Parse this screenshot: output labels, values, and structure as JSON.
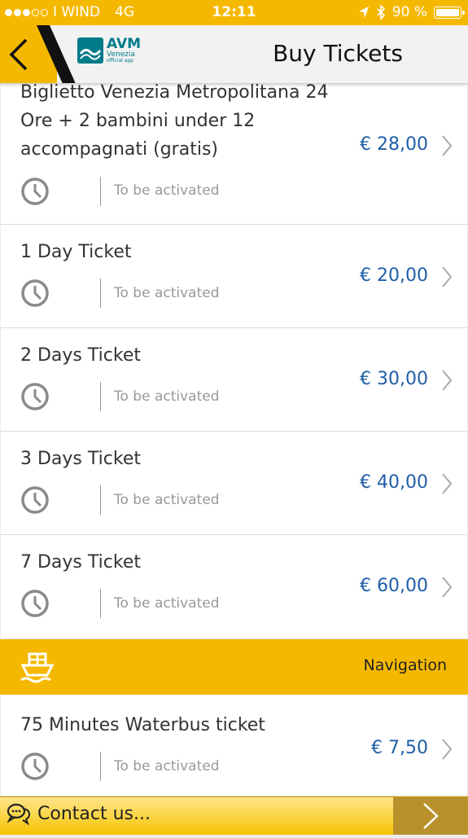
{
  "status_bar": {
    "carrier": "I WIND",
    "network": "4G",
    "time": "12:11",
    "battery": "90 %"
  },
  "header": {
    "title": "Buy Tickets",
    "logo_brand": "AVM",
    "logo_city": "Venezia",
    "logo_tagline": "official app"
  },
  "tickets": [
    {
      "name": "Biglietto Venezia Metropolitana 24 Ore + 2 bambini under 12 accompagnati (gratis)",
      "status": "To be activated",
      "price": "€ 28,00"
    },
    {
      "name": "1 Day Ticket",
      "status": "To be activated",
      "price": "€ 20,00"
    },
    {
      "name": "2 Days Ticket",
      "status": "To be activated",
      "price": "€ 30,00"
    },
    {
      "name": "3 Days Ticket",
      "status": "To be activated",
      "price": "€ 40,00"
    },
    {
      "name": "7 Days Ticket",
      "status": "To be activated",
      "price": "€ 60,00"
    }
  ],
  "section": {
    "label": "Navigation",
    "icon": "boat-icon"
  },
  "navigation_tickets": [
    {
      "name": "75 Minutes Waterbus ticket",
      "status": "To be activated",
      "price": "€ 7,50"
    }
  ],
  "bottom_bar": {
    "contact_label": "Contact us..."
  },
  "colors": {
    "accent": "#f5b800",
    "price": "#1f5fa8",
    "brand": "#007b8a"
  }
}
